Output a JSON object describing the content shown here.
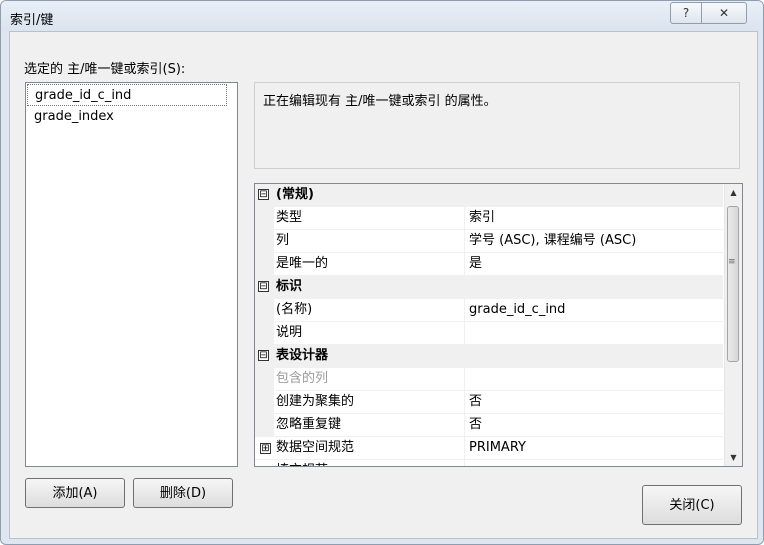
{
  "window": {
    "title": "索引/键",
    "help_glyph": "?",
    "close_glyph": "✕"
  },
  "selector": {
    "label": "选定的 主/唯一键或索引(S):",
    "items": [
      {
        "label": "grade_id_c_ind",
        "selected": true
      },
      {
        "label": "grade_index",
        "selected": false
      }
    ]
  },
  "description": "正在编辑现有 主/唯一键或索引 的属性。",
  "properties": {
    "rows": [
      {
        "type": "category",
        "expander": "⊟",
        "name": "(常规)"
      },
      {
        "type": "prop",
        "name": "类型",
        "value": "索引"
      },
      {
        "type": "prop",
        "name": "列",
        "value": "学号 (ASC), 课程编号 (ASC)"
      },
      {
        "type": "prop",
        "name": "是唯一的",
        "value": "是"
      },
      {
        "type": "category",
        "expander": "⊟",
        "name": "标识"
      },
      {
        "type": "prop",
        "name": "(名称)",
        "value": "grade_id_c_ind"
      },
      {
        "type": "prop",
        "name": "说明",
        "value": ""
      },
      {
        "type": "category",
        "expander": "⊟",
        "name": "表设计器"
      },
      {
        "type": "prop",
        "name": "包含的列",
        "value": "",
        "disabled": true
      },
      {
        "type": "prop",
        "name": "创建为聚集的",
        "value": "否"
      },
      {
        "type": "prop",
        "name": "忽略重复键",
        "value": "否"
      },
      {
        "type": "sub",
        "expander": "⊞",
        "name": "数据空间规范",
        "value": "PRIMARY"
      },
      {
        "type": "sub",
        "expander": "⊞",
        "name": "填充规范",
        "value": ""
      }
    ],
    "scroll_up": "▲",
    "scroll_down": "▼",
    "scroll_grip": "≡"
  },
  "buttons": {
    "add": "添加(A)",
    "delete": "删除(D)",
    "close": "关闭(C)"
  }
}
